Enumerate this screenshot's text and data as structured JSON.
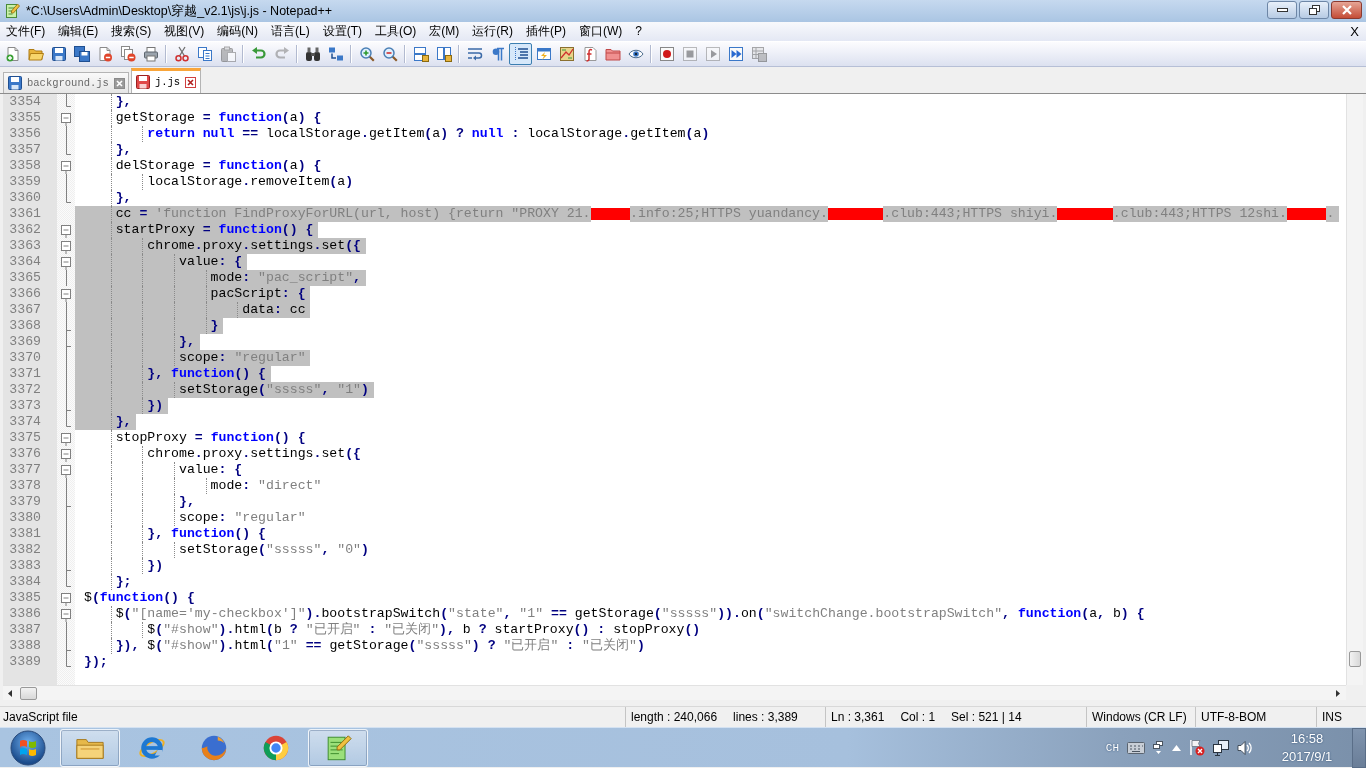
{
  "window": {
    "title": "*C:\\Users\\Admin\\Desktop\\穿越_v2.1\\js\\j.js - Notepad++"
  },
  "menu": {
    "items": [
      "文件(F)",
      "编辑(E)",
      "搜索(S)",
      "视图(V)",
      "编码(N)",
      "语言(L)",
      "设置(T)",
      "工具(O)",
      "宏(M)",
      "运行(R)",
      "插件(P)",
      "窗口(W)",
      "?"
    ],
    "close_document": "X"
  },
  "toolbar_groups": [
    {
      "buttons": [
        {
          "pressed": false,
          "disabled": false
        },
        {
          "pressed": false,
          "disabled": false
        },
        {
          "pressed": false,
          "disabled": false
        },
        {
          "pressed": false,
          "disabled": false
        },
        {
          "pressed": false,
          "disabled": false
        },
        {
          "pressed": false,
          "disabled": false
        },
        {
          "pressed": false,
          "disabled": false
        }
      ]
    },
    {
      "buttons": [
        {
          "pressed": false,
          "disabled": false
        },
        {
          "pressed": false,
          "disabled": false
        },
        {
          "pressed": false,
          "disabled": true
        }
      ]
    },
    {
      "buttons": [
        {
          "pressed": false,
          "disabled": false
        },
        {
          "pressed": false,
          "disabled": true
        }
      ]
    },
    {
      "buttons": [
        {
          "pressed": false,
          "disabled": false
        },
        {
          "pressed": false,
          "disabled": false
        }
      ]
    },
    {
      "buttons": [
        {
          "pressed": false,
          "disabled": false
        },
        {
          "pressed": false,
          "disabled": false
        }
      ]
    },
    {
      "buttons": [
        {
          "pressed": false,
          "disabled": false
        },
        {
          "pressed": false,
          "disabled": false
        }
      ]
    },
    {
      "buttons": [
        {
          "pressed": false,
          "disabled": false
        },
        {
          "pressed": false,
          "disabled": false
        },
        {
          "pressed": true,
          "disabled": false
        },
        {
          "pressed": false,
          "disabled": false
        },
        {
          "pressed": false,
          "disabled": false
        },
        {
          "pressed": false,
          "disabled": false
        },
        {
          "pressed": false,
          "disabled": false
        },
        {
          "pressed": false,
          "disabled": false
        }
      ]
    },
    {
      "buttons": [
        {
          "pressed": false,
          "disabled": false
        },
        {
          "pressed": false,
          "disabled": true
        },
        {
          "pressed": false,
          "disabled": true
        },
        {
          "pressed": false,
          "disabled": false
        },
        {
          "pressed": false,
          "disabled": true
        }
      ]
    }
  ],
  "tabs": [
    {
      "label": "background.js",
      "selected": false,
      "modified": false
    },
    {
      "label": "j.js",
      "selected": true,
      "modified": true
    }
  ],
  "editor": {
    "lines": [
      {
        "number": "3354",
        "fold_marker": {
          "kind": "end"
        },
        "selected": false,
        "tokens": [
          {
            "kind": "op",
            "text": "    },"
          }
        ]
      },
      {
        "number": "3355",
        "fold_marker": {
          "kind": "open"
        },
        "selected": false,
        "tokens": [
          {
            "kind": "ident",
            "text": "    getStorage"
          },
          {
            "kind": "op",
            "text": " = "
          },
          {
            "kind": "keyword",
            "text": "function"
          },
          {
            "kind": "op",
            "text": "("
          },
          {
            "kind": "ident",
            "text": "a"
          },
          {
            "kind": "op",
            "text": ") {"
          }
        ]
      },
      {
        "number": "3356",
        "fold_marker": {
          "kind": "line"
        },
        "selected": false,
        "tokens": [
          {
            "kind": "keyword",
            "text": "        return null"
          },
          {
            "kind": "op",
            "text": " == "
          },
          {
            "kind": "ident",
            "text": "localStorage"
          },
          {
            "kind": "op",
            "text": "."
          },
          {
            "kind": "ident",
            "text": "getItem"
          },
          {
            "kind": "op",
            "text": "("
          },
          {
            "kind": "ident",
            "text": "a"
          },
          {
            "kind": "op",
            "text": ") ? "
          },
          {
            "kind": "keyword",
            "text": "null"
          },
          {
            "kind": "op",
            "text": " : "
          },
          {
            "kind": "ident",
            "text": "localStorage"
          },
          {
            "kind": "op",
            "text": "."
          },
          {
            "kind": "ident",
            "text": "getItem"
          },
          {
            "kind": "op",
            "text": "("
          },
          {
            "kind": "ident",
            "text": "a"
          },
          {
            "kind": "op",
            "text": ")"
          }
        ]
      },
      {
        "number": "3357",
        "fold_marker": {
          "kind": "end"
        },
        "selected": false,
        "tokens": [
          {
            "kind": "op",
            "text": "    },"
          }
        ]
      },
      {
        "number": "3358",
        "fold_marker": {
          "kind": "open"
        },
        "selected": false,
        "tokens": [
          {
            "kind": "ident",
            "text": "    delStorage"
          },
          {
            "kind": "op",
            "text": " = "
          },
          {
            "kind": "keyword",
            "text": "function"
          },
          {
            "kind": "op",
            "text": "("
          },
          {
            "kind": "ident",
            "text": "a"
          },
          {
            "kind": "op",
            "text": ") {"
          }
        ]
      },
      {
        "number": "3359",
        "fold_marker": {
          "kind": "line"
        },
        "selected": false,
        "tokens": [
          {
            "kind": "ident",
            "text": "        localStorage"
          },
          {
            "kind": "op",
            "text": "."
          },
          {
            "kind": "ident",
            "text": "removeItem"
          },
          {
            "kind": "op",
            "text": "("
          },
          {
            "kind": "ident",
            "text": "a"
          },
          {
            "kind": "op",
            "text": ")"
          }
        ]
      },
      {
        "number": "3360",
        "fold_marker": {
          "kind": "end"
        },
        "selected": false,
        "tokens": [
          {
            "kind": "op",
            "text": "    },"
          }
        ]
      },
      {
        "number": "3361",
        "selected": true,
        "tokens": [
          {
            "kind": "ident",
            "text": "    cc"
          },
          {
            "kind": "op",
            "text": " = "
          },
          {
            "kind": "string",
            "text": "'function FindProxyForURL(url, host) {return \"PROXY 21."
          },
          {
            "kind": "redaction",
            "wide": false
          },
          {
            "kind": "string",
            "text": ".info:25;HTTPS yuandancy."
          },
          {
            "kind": "redaction",
            "wide": true
          },
          {
            "kind": "string",
            "text": ".club:443;HTTPS shiyi."
          },
          {
            "kind": "redaction",
            "wide": true
          },
          {
            "kind": "string",
            "text": ".club:443;HTTPS 12shi."
          },
          {
            "kind": "redaction",
            "wide": false
          },
          {
            "kind": "string",
            "text": "."
          }
        ]
      },
      {
        "number": "3362",
        "fold_marker": {
          "kind": "open"
        },
        "selected": true,
        "tokens": [
          {
            "kind": "ident",
            "text": "    startProxy"
          },
          {
            "kind": "op",
            "text": " = "
          },
          {
            "kind": "keyword",
            "text": "function"
          },
          {
            "kind": "op",
            "text": "() {"
          }
        ]
      },
      {
        "number": "3363",
        "fold_marker": {
          "kind": "open"
        },
        "selected": true,
        "tokens": [
          {
            "kind": "ident",
            "text": "        chrome"
          },
          {
            "kind": "op",
            "text": "."
          },
          {
            "kind": "ident",
            "text": "proxy"
          },
          {
            "kind": "op",
            "text": "."
          },
          {
            "kind": "ident",
            "text": "settings"
          },
          {
            "kind": "op",
            "text": "."
          },
          {
            "kind": "ident",
            "text": "set"
          },
          {
            "kind": "op",
            "text": "({"
          }
        ]
      },
      {
        "number": "3364",
        "fold_marker": {
          "kind": "open"
        },
        "selected": true,
        "tokens": [
          {
            "kind": "ident",
            "text": "            value"
          },
          {
            "kind": "op",
            "text": ": {"
          }
        ]
      },
      {
        "number": "3365",
        "fold_marker": {
          "kind": "line"
        },
        "selected": true,
        "tokens": [
          {
            "kind": "ident",
            "text": "                mode"
          },
          {
            "kind": "op",
            "text": ": "
          },
          {
            "kind": "string",
            "text": "\"pac_script\""
          },
          {
            "kind": "op",
            "text": ","
          }
        ]
      },
      {
        "number": "3366",
        "fold_marker": {
          "kind": "open"
        },
        "selected": true,
        "tokens": [
          {
            "kind": "ident",
            "text": "                pacScript"
          },
          {
            "kind": "op",
            "text": ": {"
          }
        ]
      },
      {
        "number": "3367",
        "fold_marker": {
          "kind": "line"
        },
        "selected": true,
        "tokens": [
          {
            "kind": "ident",
            "text": "                    data"
          },
          {
            "kind": "op",
            "text": ": "
          },
          {
            "kind": "ident",
            "text": "cc"
          }
        ]
      },
      {
        "number": "3368",
        "fold_marker": {
          "kind": "branch"
        },
        "selected": true,
        "tokens": [
          {
            "kind": "op",
            "text": "                }"
          }
        ]
      },
      {
        "number": "3369",
        "fold_marker": {
          "kind": "branch"
        },
        "selected": true,
        "tokens": [
          {
            "kind": "op",
            "text": "            },"
          }
        ]
      },
      {
        "number": "3370",
        "fold_marker": {
          "kind": "line"
        },
        "selected": true,
        "tokens": [
          {
            "kind": "ident",
            "text": "            scope"
          },
          {
            "kind": "op",
            "text": ": "
          },
          {
            "kind": "string",
            "text": "\"regular\""
          }
        ]
      },
      {
        "number": "3371",
        "fold_marker": {
          "kind": "line"
        },
        "selected": true,
        "tokens": [
          {
            "kind": "op",
            "text": "        }, "
          },
          {
            "kind": "keyword",
            "text": "function"
          },
          {
            "kind": "op",
            "text": "() {"
          }
        ]
      },
      {
        "number": "3372",
        "fold_marker": {
          "kind": "line"
        },
        "selected": true,
        "tokens": [
          {
            "kind": "ident",
            "text": "            setStorage"
          },
          {
            "kind": "op",
            "text": "("
          },
          {
            "kind": "string",
            "text": "\"sssss\""
          },
          {
            "kind": "op",
            "text": ", "
          },
          {
            "kind": "string",
            "text": "\"1\""
          },
          {
            "kind": "op",
            "text": ")"
          }
        ]
      },
      {
        "number": "3373",
        "fold_marker": {
          "kind": "branch"
        },
        "selected": true,
        "tokens": [
          {
            "kind": "op",
            "text": "        })"
          }
        ]
      },
      {
        "number": "3374",
        "fold_marker": {
          "kind": "end"
        },
        "selected": true,
        "tokens": [
          {
            "kind": "op",
            "text": "    },"
          }
        ]
      },
      {
        "number": "3375",
        "fold_marker": {
          "kind": "open"
        },
        "selected": false,
        "tokens": [
          {
            "kind": "ident",
            "text": "    stopProxy"
          },
          {
            "kind": "op",
            "text": " = "
          },
          {
            "kind": "keyword",
            "text": "function"
          },
          {
            "kind": "op",
            "text": "() {"
          }
        ]
      },
      {
        "number": "3376",
        "fold_marker": {
          "kind": "open"
        },
        "selected": false,
        "tokens": [
          {
            "kind": "ident",
            "text": "        chrome"
          },
          {
            "kind": "op",
            "text": "."
          },
          {
            "kind": "ident",
            "text": "proxy"
          },
          {
            "kind": "op",
            "text": "."
          },
          {
            "kind": "ident",
            "text": "settings"
          },
          {
            "kind": "op",
            "text": "."
          },
          {
            "kind": "ident",
            "text": "set"
          },
          {
            "kind": "op",
            "text": "({"
          }
        ]
      },
      {
        "number": "3377",
        "fold_marker": {
          "kind": "open"
        },
        "selected": false,
        "tokens": [
          {
            "kind": "ident",
            "text": "            value"
          },
          {
            "kind": "op",
            "text": ": {"
          }
        ]
      },
      {
        "number": "3378",
        "fold_marker": {
          "kind": "line"
        },
        "selected": false,
        "tokens": [
          {
            "kind": "ident",
            "text": "                mode"
          },
          {
            "kind": "op",
            "text": ": "
          },
          {
            "kind": "string",
            "text": "\"direct\""
          }
        ]
      },
      {
        "number": "3379",
        "fold_marker": {
          "kind": "branch"
        },
        "selected": false,
        "tokens": [
          {
            "kind": "op",
            "text": "            },"
          }
        ]
      },
      {
        "number": "3380",
        "fold_marker": {
          "kind": "line"
        },
        "selected": false,
        "tokens": [
          {
            "kind": "ident",
            "text": "            scope"
          },
          {
            "kind": "op",
            "text": ": "
          },
          {
            "kind": "string",
            "text": "\"regular\""
          }
        ]
      },
      {
        "number": "3381",
        "fold_marker": {
          "kind": "line"
        },
        "selected": false,
        "tokens": [
          {
            "kind": "op",
            "text": "        }, "
          },
          {
            "kind": "keyword",
            "text": "function"
          },
          {
            "kind": "op",
            "text": "() {"
          }
        ]
      },
      {
        "number": "3382",
        "fold_marker": {
          "kind": "line"
        },
        "selected": false,
        "tokens": [
          {
            "kind": "ident",
            "text": "            setStorage"
          },
          {
            "kind": "op",
            "text": "("
          },
          {
            "kind": "string",
            "text": "\"sssss\""
          },
          {
            "kind": "op",
            "text": ", "
          },
          {
            "kind": "string",
            "text": "\"0\""
          },
          {
            "kind": "op",
            "text": ")"
          }
        ]
      },
      {
        "number": "3383",
        "fold_marker": {
          "kind": "branch"
        },
        "selected": false,
        "tokens": [
          {
            "kind": "op",
            "text": "        })"
          }
        ]
      },
      {
        "number": "3384",
        "fold_marker": {
          "kind": "end"
        },
        "selected": false,
        "tokens": [
          {
            "kind": "op",
            "text": "    };"
          }
        ]
      },
      {
        "number": "3385",
        "fold_marker": {
          "kind": "open"
        },
        "selected": false,
        "tokens": [
          {
            "kind": "ident",
            "text": "$"
          },
          {
            "kind": "op",
            "text": "("
          },
          {
            "kind": "keyword",
            "text": "function"
          },
          {
            "kind": "op",
            "text": "() {"
          }
        ]
      },
      {
        "number": "3386",
        "fold_marker": {
          "kind": "open"
        },
        "selected": false,
        "tokens": [
          {
            "kind": "ident",
            "text": "    $"
          },
          {
            "kind": "op",
            "text": "("
          },
          {
            "kind": "string",
            "text": "\"[name='my-checkbox']\""
          },
          {
            "kind": "op",
            "text": ")."
          },
          {
            "kind": "ident",
            "text": "bootstrapSwitch"
          },
          {
            "kind": "op",
            "text": "("
          },
          {
            "kind": "string",
            "text": "\"state\""
          },
          {
            "kind": "op",
            "text": ", "
          },
          {
            "kind": "string",
            "text": "\"1\""
          },
          {
            "kind": "op",
            "text": " == "
          },
          {
            "kind": "ident",
            "text": "getStorage"
          },
          {
            "kind": "op",
            "text": "("
          },
          {
            "kind": "string",
            "text": "\"sssss\""
          },
          {
            "kind": "op",
            "text": "))."
          },
          {
            "kind": "ident",
            "text": "on"
          },
          {
            "kind": "op",
            "text": "("
          },
          {
            "kind": "string",
            "text": "\"switchChange.bootstrapSwitch\""
          },
          {
            "kind": "op",
            "text": ", "
          },
          {
            "kind": "keyword",
            "text": "function"
          },
          {
            "kind": "op",
            "text": "("
          },
          {
            "kind": "ident",
            "text": "a"
          },
          {
            "kind": "op",
            "text": ", "
          },
          {
            "kind": "ident",
            "text": "b"
          },
          {
            "kind": "op",
            "text": ") {"
          }
        ]
      },
      {
        "number": "3387",
        "fold_marker": {
          "kind": "line"
        },
        "selected": false,
        "tokens": [
          {
            "kind": "ident",
            "text": "        $"
          },
          {
            "kind": "op",
            "text": "("
          },
          {
            "kind": "string",
            "text": "\"#show\""
          },
          {
            "kind": "op",
            "text": ")."
          },
          {
            "kind": "ident",
            "text": "html"
          },
          {
            "kind": "op",
            "text": "("
          },
          {
            "kind": "ident",
            "text": "b"
          },
          {
            "kind": "op",
            "text": " ? "
          },
          {
            "kind": "string",
            "text": "\"已开启\""
          },
          {
            "kind": "op",
            "text": " : "
          },
          {
            "kind": "string",
            "text": "\"已关闭\""
          },
          {
            "kind": "op",
            "text": "), "
          },
          {
            "kind": "ident",
            "text": "b"
          },
          {
            "kind": "op",
            "text": " ? "
          },
          {
            "kind": "ident",
            "text": "startProxy"
          },
          {
            "kind": "op",
            "text": "() : "
          },
          {
            "kind": "ident",
            "text": "stopProxy"
          },
          {
            "kind": "op",
            "text": "()"
          }
        ]
      },
      {
        "number": "3388",
        "fold_marker": {
          "kind": "branch"
        },
        "selected": false,
        "tokens": [
          {
            "kind": "op",
            "text": "    }), "
          },
          {
            "kind": "ident",
            "text": "$"
          },
          {
            "kind": "op",
            "text": "("
          },
          {
            "kind": "string",
            "text": "\"#show\""
          },
          {
            "kind": "op",
            "text": ")."
          },
          {
            "kind": "ident",
            "text": "html"
          },
          {
            "kind": "op",
            "text": "("
          },
          {
            "kind": "string",
            "text": "\"1\""
          },
          {
            "kind": "op",
            "text": " == "
          },
          {
            "kind": "ident",
            "text": "getStorage"
          },
          {
            "kind": "op",
            "text": "("
          },
          {
            "kind": "string",
            "text": "\"sssss\""
          },
          {
            "kind": "op",
            "text": ") ? "
          },
          {
            "kind": "string",
            "text": "\"已开启\""
          },
          {
            "kind": "op",
            "text": " : "
          },
          {
            "kind": "string",
            "text": "\"已关闭\""
          },
          {
            "kind": "op",
            "text": ")"
          }
        ]
      },
      {
        "number": "3389",
        "fold_marker": {
          "kind": "end"
        },
        "selected": false,
        "tokens": [
          {
            "kind": "op",
            "text": "});"
          }
        ]
      }
    ]
  },
  "status_bar": [
    {
      "items": [
        "JavaScript file"
      ]
    },
    {
      "items": [
        "length : 240,066",
        "lines : 3,389"
      ]
    },
    {
      "items": [
        "Ln : 3,361",
        "Col : 1",
        "Sel : 521 | 14"
      ]
    },
    {
      "items": [
        "Windows (CR LF)"
      ]
    },
    {
      "items": [
        "UTF-8-BOM"
      ]
    },
    {
      "items": [
        "INS"
      ]
    }
  ],
  "taskbar": {
    "apps": [
      {
        "running": true
      },
      {
        "running": false
      },
      {
        "running": false
      },
      {
        "running": false
      },
      {
        "running": true
      }
    ],
    "tray": {
      "language": "CH",
      "time": "16:58",
      "date": "2017/9/1"
    }
  }
}
